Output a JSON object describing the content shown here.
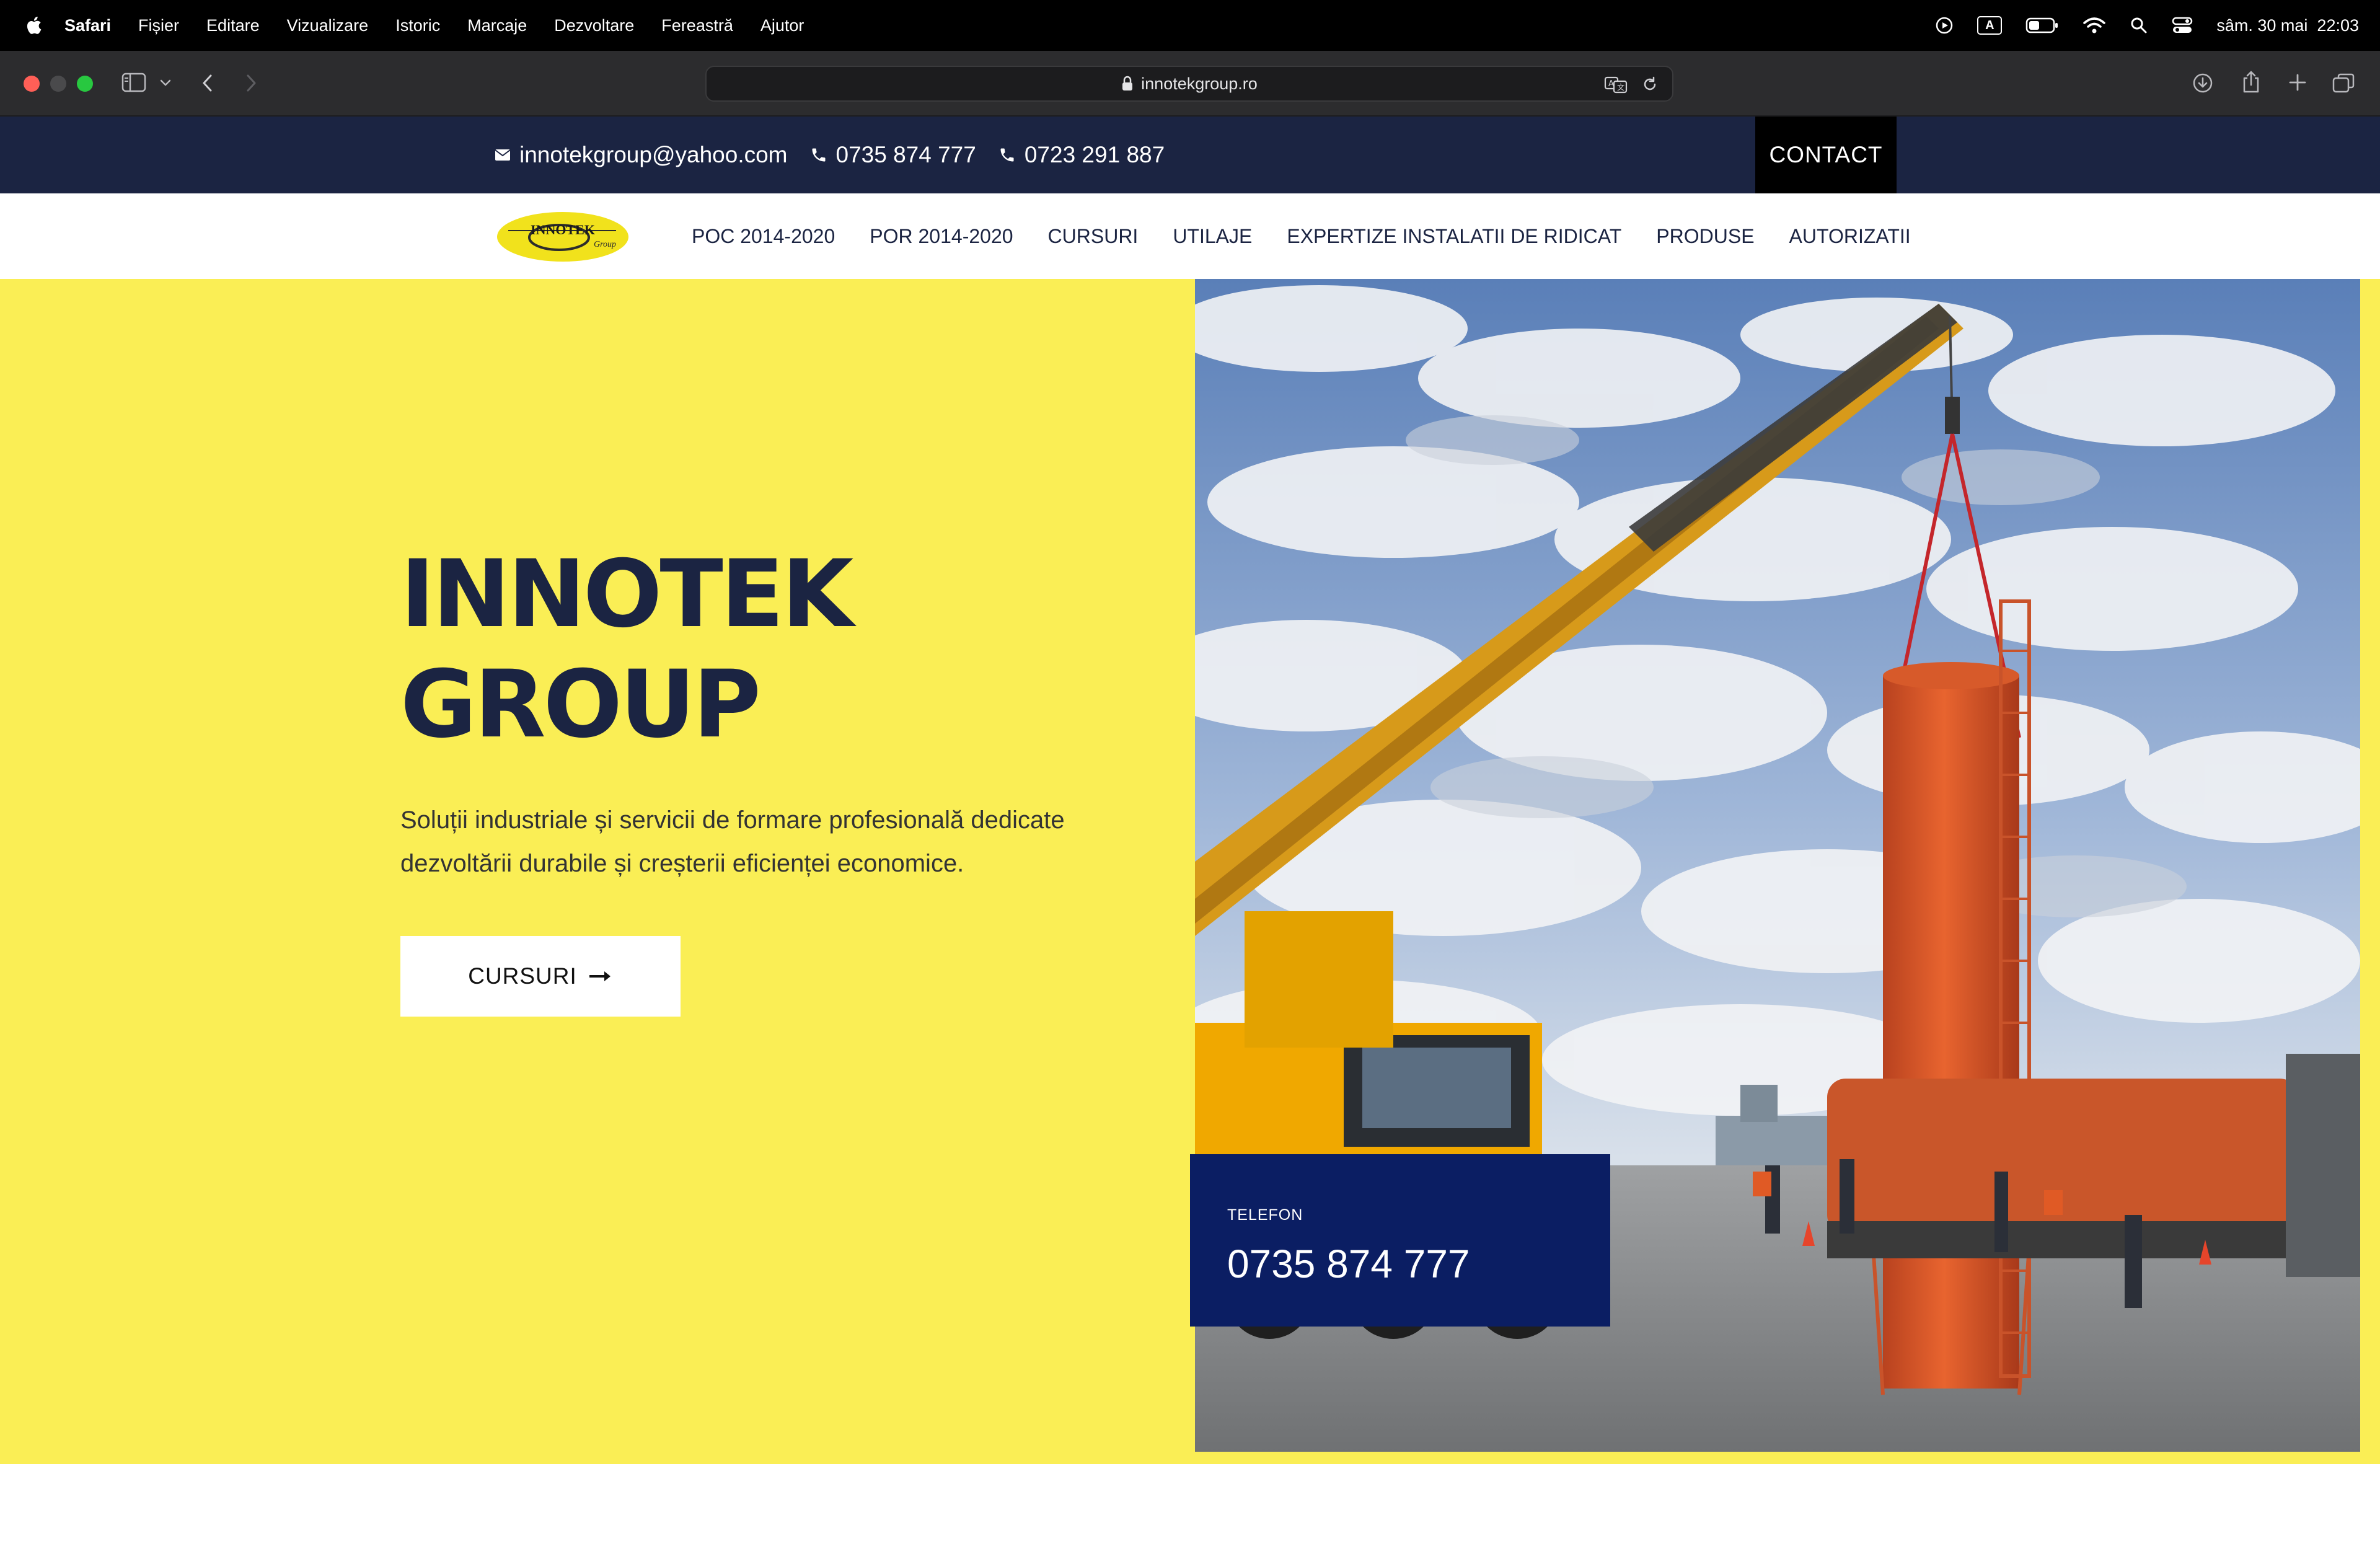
{
  "menubar": {
    "app": "Safari",
    "items": [
      "Fișier",
      "Editare",
      "Vizualizare",
      "Istoric",
      "Marcaje",
      "Dezvoltare",
      "Fereastră",
      "Ajutor"
    ],
    "keyboard_indicator": "A",
    "clock": "sâm. 30 mai  22:03"
  },
  "browser": {
    "url": "innotekgroup.ro"
  },
  "topbar": {
    "email": "innotekgroup@yahoo.com",
    "phone1": "0735 874 777",
    "phone2": "0723 291 887",
    "contact_label": "CONTACT"
  },
  "nav": {
    "logo_text": "INNOTEK",
    "logo_sub": "Group",
    "items": [
      "POC 2014-2020",
      "POR 2014-2020",
      "CURSURI",
      "UTILAJE",
      "EXPERTIZE INSTALATII DE RIDICAT",
      "PRODUSE",
      "AUTORIZATII"
    ]
  },
  "hero": {
    "title_line1": "INNOTEK",
    "title_line2": "GROUP",
    "description": "Soluții industriale și servicii de formare profesională dedicate dezvoltării durabile și creșterii eficienței economice.",
    "button_label": "CURSURI"
  },
  "phone_card": {
    "label": "TELEFON",
    "number": "0735 874 777"
  },
  "colors": {
    "topbar": "#1b2442",
    "hero_bg": "#faee55",
    "phone_card": "#0b1e63",
    "nav_text": "#1b2442"
  }
}
